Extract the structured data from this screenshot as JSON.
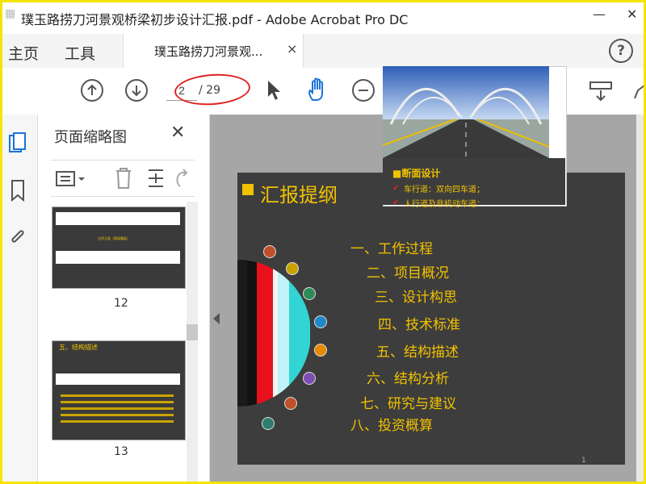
{
  "window": {
    "title": "璞玉路捞刀河景观桥梁初步设计汇报.pdf - Adobe Acrobat Pro DC",
    "min_icon": "minimize-icon",
    "close_icon": "close-icon"
  },
  "tabs": {
    "home": "主页",
    "tools": "工具",
    "document": "璞玉路捞刀河景观...",
    "close": "×"
  },
  "toolbar": {
    "current_page": "2",
    "total_pages": "/ 29",
    "help": "?"
  },
  "thumbnails": {
    "title": "页面缩略图",
    "close": "✕",
    "pages": [
      {
        "number": "12",
        "caption": "主桥立面（钢梁腹板）"
      },
      {
        "number": "13",
        "heading": "五、结构描述"
      }
    ]
  },
  "slide": {
    "title": "汇报提纲",
    "page_number": "1",
    "agenda": [
      "一、工作过程",
      "二、项目概况",
      "三、设计构思",
      "四、技术标准",
      "五、结构描述",
      "六、结构分析",
      "七、研究与建议",
      "八、投资概算"
    ],
    "dot_colors": [
      "#c0502a",
      "#c8a200",
      "#2e8b57",
      "#1e88c8",
      "#e68a00",
      "#7b4fb0",
      "#c0502a",
      "#2e7d6e"
    ]
  },
  "popup": {
    "heading": "■断面设计",
    "line1": "车行道：双向四车道；",
    "line2": "人行道及非机动车道："
  }
}
